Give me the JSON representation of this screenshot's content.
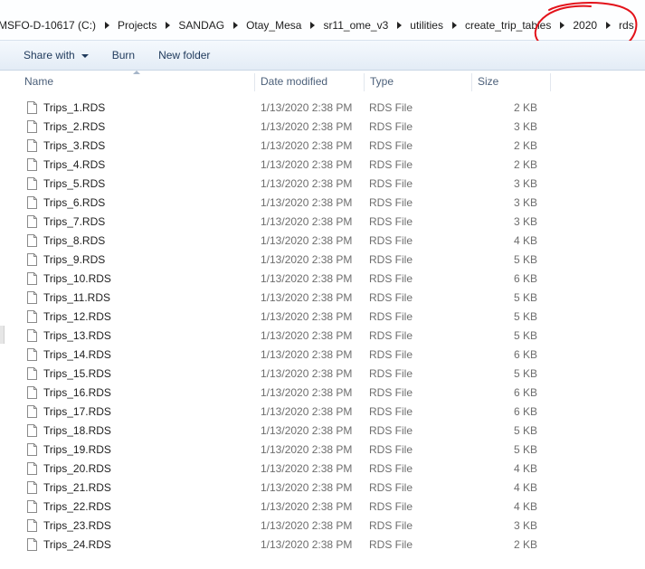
{
  "breadcrumb": {
    "items": [
      "MSFO-D-10617 (C:)",
      "Projects",
      "SANDAG",
      "Otay_Mesa",
      "sr11_ome_v3",
      "utilities",
      "create_trip_tables",
      "2020",
      "rds"
    ]
  },
  "toolbar": {
    "share_label": "Share with",
    "burn_label": "Burn",
    "new_folder_label": "New folder"
  },
  "columns": {
    "name": "Name",
    "date": "Date modified",
    "type": "Type",
    "size": "Size"
  },
  "files": [
    {
      "name": "Trips_1.RDS",
      "date": "1/13/2020 2:38 PM",
      "type": "RDS File",
      "size": "2 KB"
    },
    {
      "name": "Trips_2.RDS",
      "date": "1/13/2020 2:38 PM",
      "type": "RDS File",
      "size": "3 KB"
    },
    {
      "name": "Trips_3.RDS",
      "date": "1/13/2020 2:38 PM",
      "type": "RDS File",
      "size": "2 KB"
    },
    {
      "name": "Trips_4.RDS",
      "date": "1/13/2020 2:38 PM",
      "type": "RDS File",
      "size": "2 KB"
    },
    {
      "name": "Trips_5.RDS",
      "date": "1/13/2020 2:38 PM",
      "type": "RDS File",
      "size": "3 KB"
    },
    {
      "name": "Trips_6.RDS",
      "date": "1/13/2020 2:38 PM",
      "type": "RDS File",
      "size": "3 KB"
    },
    {
      "name": "Trips_7.RDS",
      "date": "1/13/2020 2:38 PM",
      "type": "RDS File",
      "size": "3 KB"
    },
    {
      "name": "Trips_8.RDS",
      "date": "1/13/2020 2:38 PM",
      "type": "RDS File",
      "size": "4 KB"
    },
    {
      "name": "Trips_9.RDS",
      "date": "1/13/2020 2:38 PM",
      "type": "RDS File",
      "size": "5 KB"
    },
    {
      "name": "Trips_10.RDS",
      "date": "1/13/2020 2:38 PM",
      "type": "RDS File",
      "size": "6 KB"
    },
    {
      "name": "Trips_11.RDS",
      "date": "1/13/2020 2:38 PM",
      "type": "RDS File",
      "size": "5 KB"
    },
    {
      "name": "Trips_12.RDS",
      "date": "1/13/2020 2:38 PM",
      "type": "RDS File",
      "size": "5 KB"
    },
    {
      "name": "Trips_13.RDS",
      "date": "1/13/2020 2:38 PM",
      "type": "RDS File",
      "size": "5 KB"
    },
    {
      "name": "Trips_14.RDS",
      "date": "1/13/2020 2:38 PM",
      "type": "RDS File",
      "size": "6 KB"
    },
    {
      "name": "Trips_15.RDS",
      "date": "1/13/2020 2:38 PM",
      "type": "RDS File",
      "size": "5 KB"
    },
    {
      "name": "Trips_16.RDS",
      "date": "1/13/2020 2:38 PM",
      "type": "RDS File",
      "size": "6 KB"
    },
    {
      "name": "Trips_17.RDS",
      "date": "1/13/2020 2:38 PM",
      "type": "RDS File",
      "size": "6 KB"
    },
    {
      "name": "Trips_18.RDS",
      "date": "1/13/2020 2:38 PM",
      "type": "RDS File",
      "size": "5 KB"
    },
    {
      "name": "Trips_19.RDS",
      "date": "1/13/2020 2:38 PM",
      "type": "RDS File",
      "size": "5 KB"
    },
    {
      "name": "Trips_20.RDS",
      "date": "1/13/2020 2:38 PM",
      "type": "RDS File",
      "size": "4 KB"
    },
    {
      "name": "Trips_21.RDS",
      "date": "1/13/2020 2:38 PM",
      "type": "RDS File",
      "size": "4 KB"
    },
    {
      "name": "Trips_22.RDS",
      "date": "1/13/2020 2:38 PM",
      "type": "RDS File",
      "size": "4 KB"
    },
    {
      "name": "Trips_23.RDS",
      "date": "1/13/2020 2:38 PM",
      "type": "RDS File",
      "size": "3 KB"
    },
    {
      "name": "Trips_24.RDS",
      "date": "1/13/2020 2:38 PM",
      "type": "RDS File",
      "size": "2 KB"
    }
  ],
  "annotation_color": "#e3121a",
  "file_icon": "generic-file-icon"
}
